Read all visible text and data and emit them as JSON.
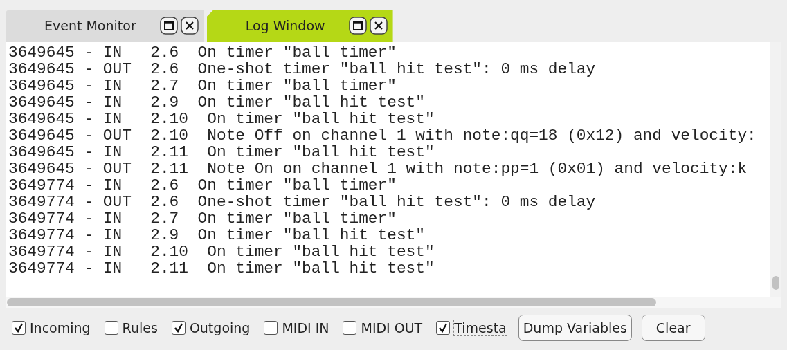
{
  "tabs": [
    {
      "label": "Event Monitor",
      "selected": false
    },
    {
      "label": "Log Window",
      "selected": true
    }
  ],
  "log_lines": [
    "3649645 - IN   2.6  On timer \"ball timer\"",
    "3649645 - OUT  2.6  One-shot timer \"ball hit test\": 0 ms delay",
    "3649645 - IN   2.7  On timer \"ball timer\"",
    "3649645 - IN   2.9  On timer \"ball hit test\"",
    "3649645 - IN   2.10  On timer \"ball hit test\"",
    "3649645 - OUT  2.10  Note Off on channel 1 with note:qq=18 (0x12) and velocity:",
    "3649645 - IN   2.11  On timer \"ball hit test\"",
    "3649645 - OUT  2.11  Note On on channel 1 with note:pp=1 (0x01) and velocity:k",
    "3649774 - IN   2.6  On timer \"ball timer\"",
    "3649774 - OUT  2.6  One-shot timer \"ball hit test\": 0 ms delay",
    "3649774 - IN   2.7  On timer \"ball timer\"",
    "3649774 - IN   2.9  On timer \"ball hit test\"",
    "3649774 - IN   2.10  On timer \"ball hit test\"",
    "3649774 - IN   2.11  On timer \"ball hit test\""
  ],
  "filters": [
    {
      "label": "Incoming",
      "checked": true,
      "focused": false
    },
    {
      "label": "Rules",
      "checked": false,
      "focused": false
    },
    {
      "label": "Outgoing",
      "checked": true,
      "focused": false
    },
    {
      "label": "MIDI IN",
      "checked": false,
      "focused": false
    },
    {
      "label": "MIDI OUT",
      "checked": false,
      "focused": false
    },
    {
      "label": "Timesta",
      "checked": true,
      "focused": true
    }
  ],
  "buttons": [
    "Dump Variables",
    "Clear"
  ]
}
